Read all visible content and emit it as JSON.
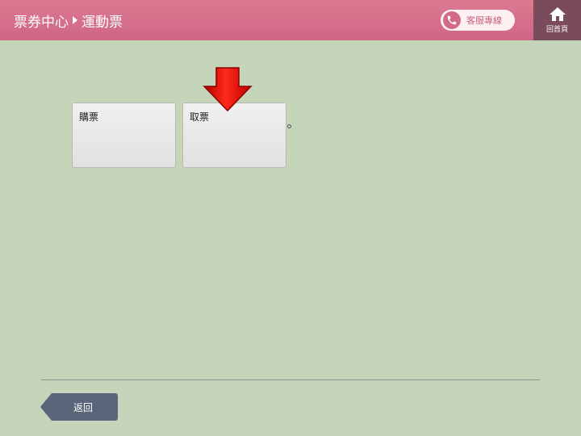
{
  "header": {
    "breadcrumb": [
      "票券中心",
      "運動票"
    ],
    "service_label": "客服專線",
    "home_label": "回首頁"
  },
  "tiles": [
    {
      "label": "購票"
    },
    {
      "label": "取票"
    }
  ],
  "footer": {
    "back_label": "返回"
  },
  "colors": {
    "header": "#d46f89",
    "background": "#c5d5b9",
    "home_bg": "#7a4c5b",
    "back_button": "#5b6579",
    "arrow": "#e00000"
  },
  "icons": {
    "phone": "phone-icon",
    "home": "home-icon",
    "pointer": "arrow-down-icon",
    "separator": "triangle-right-icon"
  }
}
